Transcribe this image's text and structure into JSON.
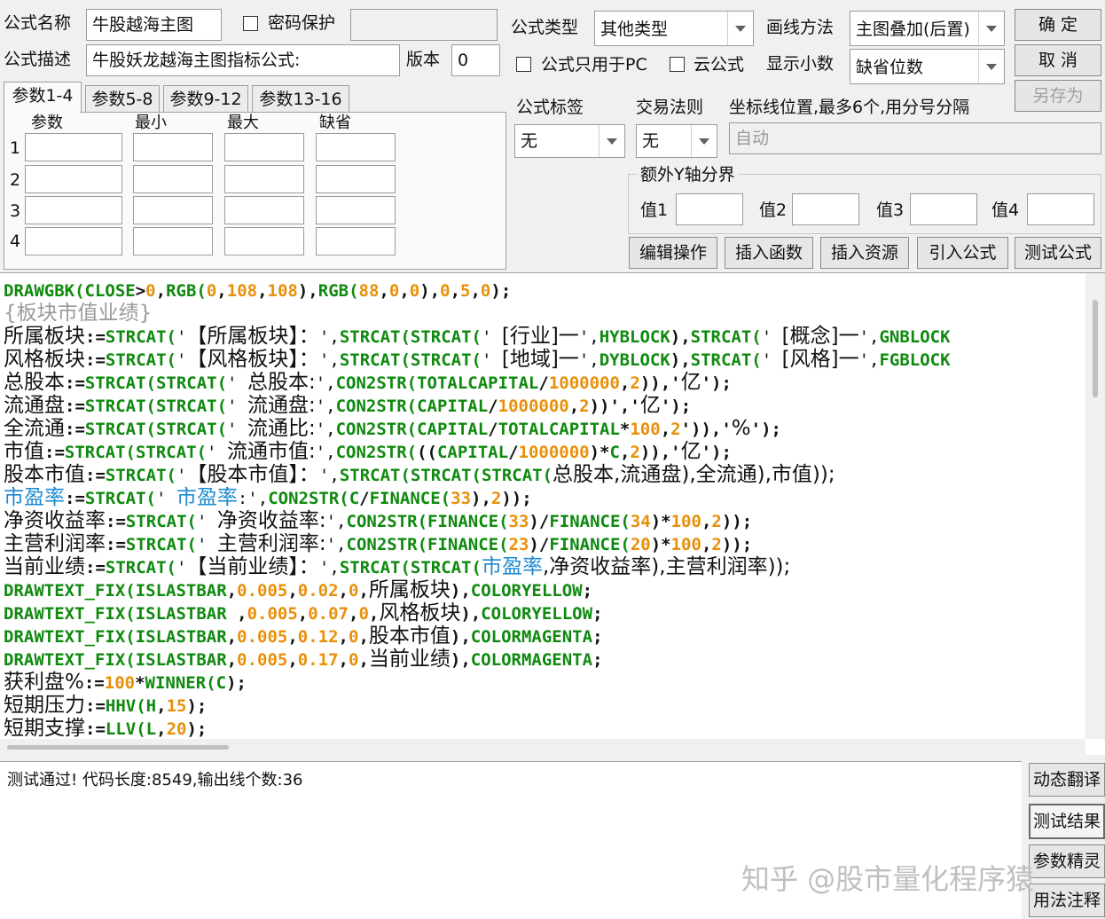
{
  "header": {
    "name_label": "公式名称",
    "name_value": "牛股越海主图",
    "password_label": "密码保护",
    "desc_label": "公式描述",
    "desc_value": "牛股妖龙越海主图指标公式:",
    "version_label": "版本",
    "version_value": "0",
    "type_label": "公式类型",
    "type_value": "其他类型",
    "draw_label": "画线方法",
    "draw_value": "主图叠加(后置)",
    "pc_only_label": "公式只用于PC",
    "cloud_label": "云公式",
    "decimal_label": "显示小数",
    "decimal_value": "缺省位数",
    "ok_label": "确  定",
    "cancel_label": "取  消",
    "saveas_label": "另存为"
  },
  "params": {
    "tabs": [
      "参数1-4",
      "参数5-8",
      "参数9-12",
      "参数13-16"
    ],
    "columns": [
      "参数",
      "最小",
      "最大",
      "缺省"
    ],
    "rows": [
      "1",
      "2",
      "3",
      "4"
    ]
  },
  "tags": {
    "tag_label": "公式标签",
    "tag_value": "无",
    "trade_label": "交易法则",
    "trade_value": "无",
    "axis_label": "坐标线位置,最多6个,用分号分隔",
    "axis_value": "自动",
    "yaxis_group_label": "额外Y轴分界",
    "yvalues": [
      "值1",
      "值2",
      "值3",
      "值4"
    ]
  },
  "actions": [
    "编辑操作",
    "插入函数",
    "插入资源",
    "引入公式",
    "测试公式"
  ],
  "code_lines": [
    [
      [
        "fn",
        "DRAWGBK("
      ],
      [
        "fn",
        "CLOSE"
      ],
      [
        "op",
        ">"
      ],
      [
        "num",
        "0"
      ],
      [
        "op",
        ","
      ],
      [
        "fn",
        "RGB("
      ],
      [
        "num",
        "0"
      ],
      [
        "op",
        ","
      ],
      [
        "num",
        "108"
      ],
      [
        "op",
        ","
      ],
      [
        "num",
        "108"
      ],
      [
        "op",
        "),"
      ],
      [
        "fn",
        "RGB("
      ],
      [
        "num",
        "88"
      ],
      [
        "op",
        ","
      ],
      [
        "num",
        "0"
      ],
      [
        "op",
        ","
      ],
      [
        "num",
        "0"
      ],
      [
        "op",
        "),"
      ],
      [
        "num",
        "0"
      ],
      [
        "op",
        ","
      ],
      [
        "num",
        "5"
      ],
      [
        "op",
        ","
      ],
      [
        "num",
        "0"
      ],
      [
        "op",
        ");"
      ]
    ],
    [
      [
        "cmt",
        "{板块市值业绩}"
      ]
    ],
    [
      [
        "var",
        "所属板块"
      ],
      [
        "op",
        ":="
      ],
      [
        "fn",
        "STRCAT("
      ],
      [
        "str",
        "'"
      ],
      [
        "var",
        "【所属板块】："
      ],
      [
        "str",
        "',"
      ],
      [
        "fn",
        "STRCAT("
      ],
      [
        "fn",
        "STRCAT("
      ],
      [
        "str",
        "' "
      ],
      [
        "var",
        "[行业]一"
      ],
      [
        "str",
        "',"
      ],
      [
        "fn",
        "HYBLOCK"
      ],
      [
        "op",
        "),"
      ],
      [
        "fn",
        "STRCAT("
      ],
      [
        "str",
        "' "
      ],
      [
        "var",
        "[概念]一"
      ],
      [
        "str",
        "',"
      ],
      [
        "fn",
        "GNBLOCK"
      ]
    ],
    [
      [
        "var",
        "风格板块"
      ],
      [
        "op",
        ":="
      ],
      [
        "fn",
        "STRCAT("
      ],
      [
        "str",
        "'"
      ],
      [
        "var",
        "【风格板块】："
      ],
      [
        "str",
        "',"
      ],
      [
        "fn",
        "STRCAT("
      ],
      [
        "fn",
        "STRCAT("
      ],
      [
        "str",
        "' "
      ],
      [
        "var",
        "[地域]一"
      ],
      [
        "str",
        "',"
      ],
      [
        "fn",
        "DYBLOCK"
      ],
      [
        "op",
        "),"
      ],
      [
        "fn",
        "STRCAT("
      ],
      [
        "str",
        "' "
      ],
      [
        "var",
        "[风格]一"
      ],
      [
        "str",
        "',"
      ],
      [
        "fn",
        "FGBLOCK"
      ]
    ],
    [
      [
        "var",
        "总股本"
      ],
      [
        "op",
        ":="
      ],
      [
        "fn",
        "STRCAT("
      ],
      [
        "fn",
        "STRCAT("
      ],
      [
        "str",
        "' "
      ],
      [
        "var",
        "总股本:"
      ],
      [
        "str",
        "',"
      ],
      [
        "fn",
        "CON2STR("
      ],
      [
        "fn",
        "TOTALCAPITAL"
      ],
      [
        "op",
        "/"
      ],
      [
        "num",
        "1000000"
      ],
      [
        "op",
        ","
      ],
      [
        "num",
        "2"
      ],
      [
        "op",
        ")),'"
      ],
      [
        "var",
        "亿"
      ],
      [
        "op",
        "');"
      ]
    ],
    [
      [
        "var",
        "流通盘"
      ],
      [
        "op",
        ":="
      ],
      [
        "fn",
        "STRCAT("
      ],
      [
        "fn",
        "STRCAT("
      ],
      [
        "str",
        "' "
      ],
      [
        "var",
        "流通盘:"
      ],
      [
        "str",
        "',"
      ],
      [
        "fn",
        "CON2STR("
      ],
      [
        "fn",
        "CAPITAL"
      ],
      [
        "op",
        "/"
      ],
      [
        "num",
        "1000000"
      ],
      [
        "op",
        ","
      ],
      [
        "num",
        "2"
      ],
      [
        "op",
        "))','"
      ],
      [
        "var",
        "亿"
      ],
      [
        "op",
        "');"
      ]
    ],
    [
      [
        "var",
        "全流通"
      ],
      [
        "op",
        ":="
      ],
      [
        "fn",
        "STRCAT("
      ],
      [
        "fn",
        "STRCAT("
      ],
      [
        "str",
        "' "
      ],
      [
        "var",
        "流通比:"
      ],
      [
        "str",
        "',"
      ],
      [
        "fn",
        "CON2STR("
      ],
      [
        "fn",
        "CAPITAL"
      ],
      [
        "op",
        "/"
      ],
      [
        "fn",
        "TOTALCAPITAL"
      ],
      [
        "op",
        "*"
      ],
      [
        "num",
        "100"
      ],
      [
        "op",
        ","
      ],
      [
        "num",
        "2"
      ],
      [
        "op",
        "')),'"
      ],
      [
        "var",
        "%"
      ],
      [
        "op",
        "');"
      ]
    ],
    [
      [
        "var",
        "市值"
      ],
      [
        "op",
        ":="
      ],
      [
        "fn",
        "STRCAT("
      ],
      [
        "fn",
        "STRCAT("
      ],
      [
        "str",
        "' "
      ],
      [
        "var",
        "流通市值:"
      ],
      [
        "str",
        "',"
      ],
      [
        "fn",
        "CON2STR("
      ],
      [
        "op",
        "(("
      ],
      [
        "fn",
        "CAPITAL"
      ],
      [
        "op",
        "/"
      ],
      [
        "num",
        "1000000"
      ],
      [
        "op",
        ")*"
      ],
      [
        "fn",
        "C"
      ],
      [
        "op",
        ","
      ],
      [
        "num",
        "2"
      ],
      [
        "op",
        ")),'"
      ],
      [
        "var",
        "亿"
      ],
      [
        "op",
        "');"
      ]
    ],
    [
      [
        "var",
        "股本市值"
      ],
      [
        "op",
        ":="
      ],
      [
        "fn",
        "STRCAT("
      ],
      [
        "str",
        "'"
      ],
      [
        "var",
        "【股本市值】："
      ],
      [
        "str",
        "',"
      ],
      [
        "fn",
        "STRCAT("
      ],
      [
        "fn",
        "STRCAT("
      ],
      [
        "fn",
        "STRCAT("
      ],
      [
        "var",
        "总股本,流通盘),全流通),市值));"
      ]
    ],
    [
      [
        "blue",
        "市盈率"
      ],
      [
        "op",
        ":="
      ],
      [
        "fn",
        "STRCAT("
      ],
      [
        "str",
        "' "
      ],
      [
        "blue",
        "市盈率"
      ],
      [
        "str",
        ":',"
      ],
      [
        "fn",
        "CON2STR("
      ],
      [
        "fn",
        "C"
      ],
      [
        "op",
        "/"
      ],
      [
        "fn",
        "FINANCE("
      ],
      [
        "num",
        "33"
      ],
      [
        "op",
        "),"
      ],
      [
        "num",
        "2"
      ],
      [
        "op",
        "));"
      ]
    ],
    [
      [
        "var",
        "净资收益率"
      ],
      [
        "op",
        ":="
      ],
      [
        "fn",
        "STRCAT("
      ],
      [
        "str",
        "' "
      ],
      [
        "var",
        "净资收益率:"
      ],
      [
        "str",
        "',"
      ],
      [
        "fn",
        "CON2STR("
      ],
      [
        "fn",
        "FINANCE("
      ],
      [
        "num",
        "33"
      ],
      [
        "op",
        ")/"
      ],
      [
        "fn",
        "FINANCE("
      ],
      [
        "num",
        "34"
      ],
      [
        "op",
        ")*"
      ],
      [
        "num",
        "100"
      ],
      [
        "op",
        ","
      ],
      [
        "num",
        "2"
      ],
      [
        "op",
        "));"
      ]
    ],
    [
      [
        "var",
        "主营利润率"
      ],
      [
        "op",
        ":="
      ],
      [
        "fn",
        "STRCAT("
      ],
      [
        "str",
        "' "
      ],
      [
        "var",
        "主营利润率:"
      ],
      [
        "str",
        "',"
      ],
      [
        "fn",
        "CON2STR("
      ],
      [
        "fn",
        "FINANCE("
      ],
      [
        "num",
        "23"
      ],
      [
        "op",
        ")/"
      ],
      [
        "fn",
        "FINANCE("
      ],
      [
        "num",
        "20"
      ],
      [
        "op",
        ")*"
      ],
      [
        "num",
        "100"
      ],
      [
        "op",
        ","
      ],
      [
        "num",
        "2"
      ],
      [
        "op",
        "));"
      ]
    ],
    [
      [
        "var",
        "当前业绩"
      ],
      [
        "op",
        ":="
      ],
      [
        "fn",
        "STRCAT("
      ],
      [
        "str",
        "'"
      ],
      [
        "var",
        "【当前业绩】："
      ],
      [
        "str",
        "',"
      ],
      [
        "fn",
        "STRCAT("
      ],
      [
        "fn",
        "STRCAT("
      ],
      [
        "blue",
        "市盈率"
      ],
      [
        "var",
        ",净资收益率),主营利润率));"
      ]
    ],
    [
      [
        "fn",
        "DRAWTEXT_FIX("
      ],
      [
        "fn",
        "ISLASTBAR"
      ],
      [
        "op",
        ","
      ],
      [
        "num",
        "0.005"
      ],
      [
        "op",
        ","
      ],
      [
        "num",
        "0.02"
      ],
      [
        "op",
        ","
      ],
      [
        "num",
        "0"
      ],
      [
        "op",
        ","
      ],
      [
        "var",
        "所属板块"
      ],
      [
        "op",
        "),"
      ],
      [
        "fn",
        "COLORYELLOW"
      ],
      [
        "op",
        ";"
      ]
    ],
    [
      [
        "fn",
        "DRAWTEXT_FIX("
      ],
      [
        "fn",
        "ISLASTBAR"
      ],
      [
        "op",
        " ,"
      ],
      [
        "num",
        "0.005"
      ],
      [
        "op",
        ","
      ],
      [
        "num",
        "0.07"
      ],
      [
        "op",
        ","
      ],
      [
        "num",
        "0"
      ],
      [
        "op",
        ","
      ],
      [
        "var",
        "风格板块"
      ],
      [
        "op",
        "),"
      ],
      [
        "fn",
        "COLORYELLOW"
      ],
      [
        "op",
        ";"
      ]
    ],
    [
      [
        "fn",
        "DRAWTEXT_FIX("
      ],
      [
        "fn",
        "ISLASTBAR"
      ],
      [
        "op",
        ","
      ],
      [
        "num",
        "0.005"
      ],
      [
        "op",
        ","
      ],
      [
        "num",
        "0.12"
      ],
      [
        "op",
        ","
      ],
      [
        "num",
        "0"
      ],
      [
        "op",
        ","
      ],
      [
        "var",
        "股本市值"
      ],
      [
        "op",
        "),"
      ],
      [
        "fn",
        "COLORMAGENTA"
      ],
      [
        "op",
        ";"
      ]
    ],
    [
      [
        "fn",
        "DRAWTEXT_FIX("
      ],
      [
        "fn",
        "ISLASTBAR"
      ],
      [
        "op",
        ","
      ],
      [
        "num",
        "0.005"
      ],
      [
        "op",
        ","
      ],
      [
        "num",
        "0.17"
      ],
      [
        "op",
        ","
      ],
      [
        "num",
        "0"
      ],
      [
        "op",
        ","
      ],
      [
        "var",
        "当前业绩"
      ],
      [
        "op",
        "),"
      ],
      [
        "fn",
        "COLORMAGENTA"
      ],
      [
        "op",
        ";"
      ]
    ],
    [
      [
        "var",
        "获利盘%"
      ],
      [
        "op",
        ":="
      ],
      [
        "num",
        "100"
      ],
      [
        "op",
        "*"
      ],
      [
        "fn",
        "WINNER("
      ],
      [
        "fn",
        "C"
      ],
      [
        "op",
        ");"
      ]
    ],
    [
      [
        "var",
        "短期压力"
      ],
      [
        "op",
        ":="
      ],
      [
        "fn",
        "HHV("
      ],
      [
        "fn",
        "H"
      ],
      [
        "op",
        ","
      ],
      [
        "num",
        "15"
      ],
      [
        "op",
        ");"
      ]
    ],
    [
      [
        "var",
        "短期支撑"
      ],
      [
        "op",
        ":="
      ],
      [
        "fn",
        "LLV("
      ],
      [
        "fn",
        "L"
      ],
      [
        "op",
        ","
      ],
      [
        "num",
        "20"
      ],
      [
        "op",
        ");"
      ]
    ]
  ],
  "result": {
    "text": "测试通过! 代码长度:8549,输出线个数:36"
  },
  "side_buttons": [
    "动态翻译",
    "测试结果",
    "参数精灵",
    "用法注释"
  ],
  "watermark": "知乎 @股市量化程序猿",
  "colors": {
    "function": "#0f8a0f",
    "number": "#e8900a",
    "comment": "#9a9a9a",
    "highlight": "#1e8ad0"
  }
}
